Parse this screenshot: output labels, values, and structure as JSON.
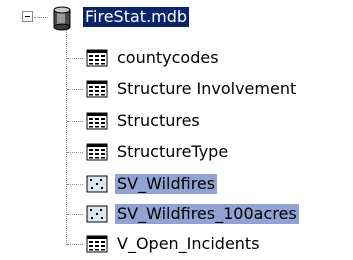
{
  "root": {
    "label": "FireStat.mdb",
    "icon": "database-icon",
    "expanded": true
  },
  "items": [
    {
      "label": "countycodes",
      "icon": "table-icon",
      "selected": false
    },
    {
      "label": "Structure Involvement",
      "icon": "table-icon",
      "selected": false
    },
    {
      "label": "Structures",
      "icon": "table-icon",
      "selected": false
    },
    {
      "label": "StructureType",
      "icon": "table-icon",
      "selected": false
    },
    {
      "label": "SV_Wildfires",
      "icon": "point-feature-class-icon",
      "selected": true
    },
    {
      "label": "SV_Wildfires_100acres",
      "icon": "point-feature-class-icon",
      "selected": true
    },
    {
      "label": "V_Open_Incidents",
      "icon": "table-icon",
      "selected": false
    }
  ],
  "colors": {
    "root_highlight": "#0a246a",
    "selection": "#d2dbf2",
    "selection_dots": "#7c8fc7"
  }
}
